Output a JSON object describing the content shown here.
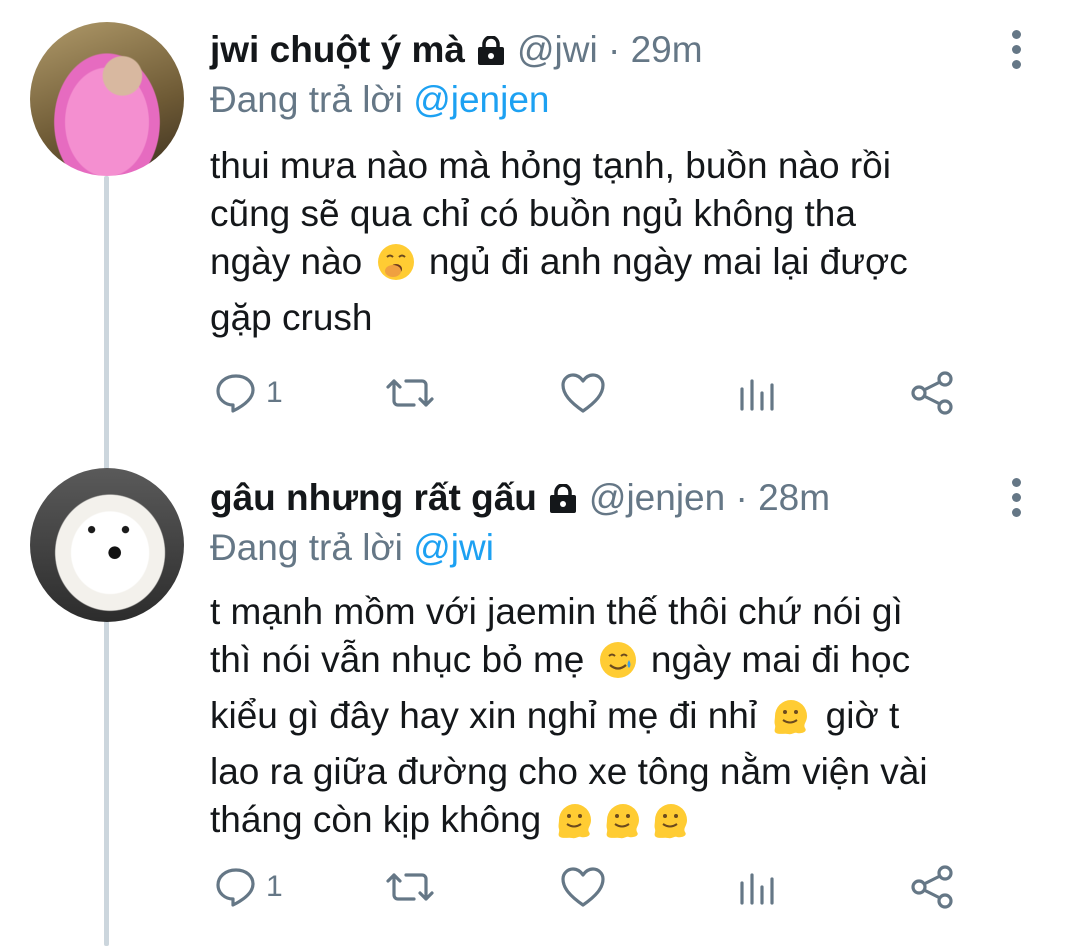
{
  "tweets": [
    {
      "name": "jwi chuột ý mà",
      "handle": "@jwi",
      "time": "29m",
      "replying_label": "Đang trả lời",
      "replying_to": "@jenjen",
      "text_lines": [
        "thui mưa nào mà hỏng tạnh, buồn nào rồi",
        "cũng sẽ qua chỉ có buồn ngủ không tha",
        "ngày nào",
        "ngủ đi anh ngày mai lại được",
        "gặp crush"
      ],
      "reply_count": "1"
    },
    {
      "name": "gâu nhưng rất gấu",
      "handle": "@jenjen",
      "time": "28m",
      "replying_label": "Đang trả lời",
      "replying_to": "@jwi",
      "text_lines": [
        "t mạnh mồm với jaemin thế thôi chứ nói gì",
        "thì nói vẫn nhục bỏ mẹ",
        "ngày mai đi học",
        "kiểu gì đây hay xin nghỉ mẹ đi nhỉ",
        "giờ t",
        "lao ra giữa đường cho xe tông nằm viện vài",
        "tháng còn kịp không"
      ],
      "reply_count": "1"
    }
  ],
  "icons": {
    "lock": "lock-icon",
    "reply": "reply-icon",
    "retweet": "retweet-icon",
    "like": "heart-icon",
    "analytics": "analytics-icon",
    "share": "share-icon",
    "more": "more-options-icon",
    "emoji_yawn": "yawning-face-emoji",
    "emoji_tear": "smiling-face-with-tear-emoji",
    "emoji_melt": "melting-face-emoji"
  },
  "colors": {
    "link": "#1da1f2",
    "muted": "#657786",
    "text": "#14171a",
    "thread_line": "#ccd6dd"
  }
}
